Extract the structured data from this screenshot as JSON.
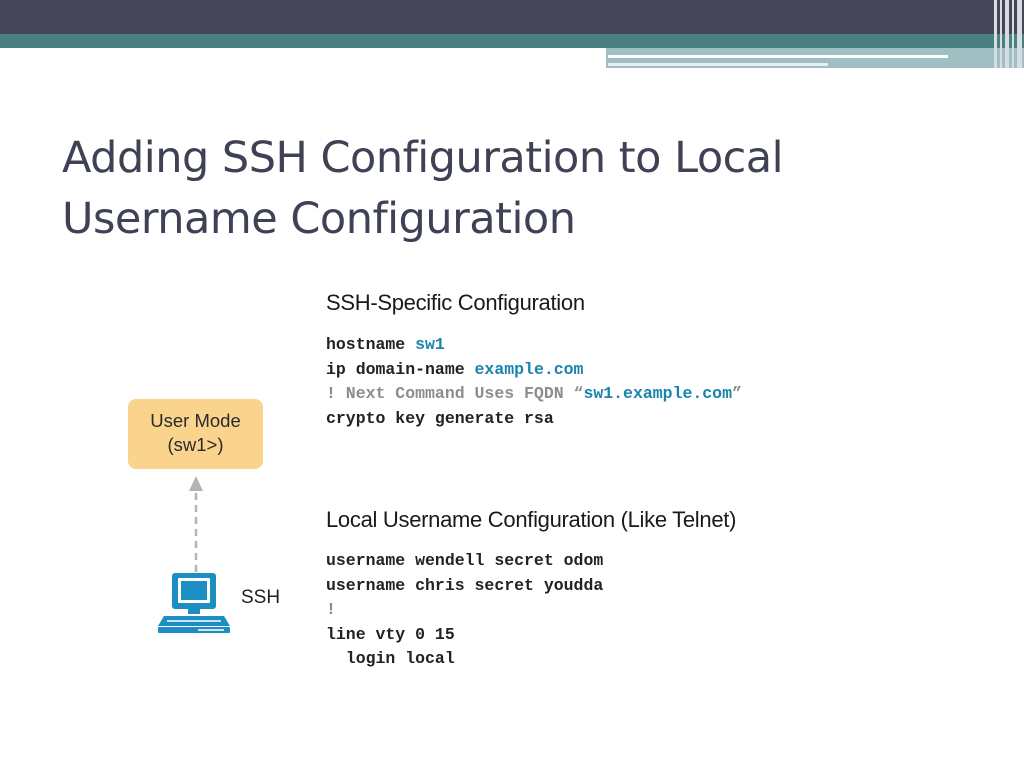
{
  "slide": {
    "title_line1": "Adding SSH Configuration to Local",
    "title_line2": "Username Configuration"
  },
  "ssh_section": {
    "heading": "SSH-Specific Configuration",
    "lines": [
      [
        {
          "t": "hostname ",
          "s": "n"
        },
        {
          "t": "sw1",
          "s": "h"
        }
      ],
      [
        {
          "t": "ip domain-name ",
          "s": "n"
        },
        {
          "t": "example.com",
          "s": "h"
        }
      ],
      [
        {
          "t": "! Next Command Uses FQDN “",
          "s": "c"
        },
        {
          "t": "sw1.example.com",
          "s": "h"
        },
        {
          "t": "”",
          "s": "c"
        }
      ],
      [
        {
          "t": "crypto key generate rsa",
          "s": "n"
        }
      ]
    ]
  },
  "local_section": {
    "heading": "Local Username Configuration (Like Telnet)",
    "lines": [
      [
        {
          "t": "username wendell secret odom",
          "s": "n"
        }
      ],
      [
        {
          "t": "username chris secret youdda",
          "s": "n"
        }
      ],
      [
        {
          "t": "!",
          "s": "c"
        }
      ],
      [
        {
          "t": "line vty 0 15",
          "s": "n"
        }
      ],
      [
        {
          "t": "  login local",
          "s": "n"
        }
      ]
    ]
  },
  "diagram": {
    "user_mode_line1": "User Mode",
    "user_mode_line2": "(sw1>)",
    "connection_label": "SSH",
    "pc_icon": "computer-icon",
    "box_color": "#fad48d",
    "icon_color": "#1d8ec4"
  },
  "colors": {
    "title": "#3f4255",
    "highlight": "#1a84ad",
    "comment": "#8d8d8d",
    "header_dark": "#454759",
    "header_teal": "#4c7f83"
  }
}
